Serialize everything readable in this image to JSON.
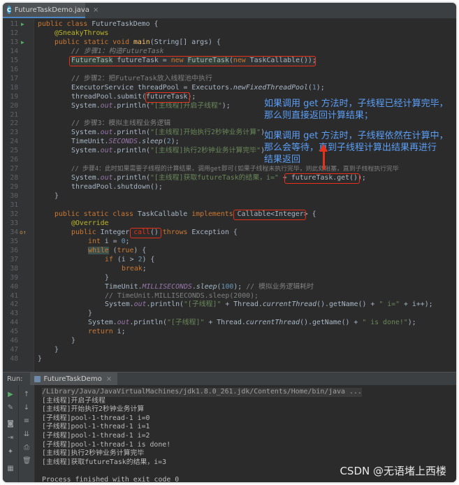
{
  "tab": {
    "file_icon": "C",
    "name": "FutureTaskDemo.java",
    "close": "×"
  },
  "code_lines": [
    {
      "n": "11",
      "icon": "run"
    },
    {
      "n": "12",
      "icon": ""
    },
    {
      "n": "13",
      "icon": "run"
    },
    {
      "n": "14",
      "icon": ""
    },
    {
      "n": "15",
      "icon": ""
    },
    {
      "n": "16",
      "icon": ""
    },
    {
      "n": "17",
      "icon": ""
    },
    {
      "n": "18",
      "icon": ""
    },
    {
      "n": "19",
      "icon": ""
    },
    {
      "n": "20",
      "icon": ""
    },
    {
      "n": "21",
      "icon": ""
    },
    {
      "n": "22",
      "icon": ""
    },
    {
      "n": "23",
      "icon": ""
    },
    {
      "n": "24",
      "icon": ""
    },
    {
      "n": "25",
      "icon": ""
    },
    {
      "n": "26",
      "icon": ""
    },
    {
      "n": "27",
      "icon": ""
    },
    {
      "n": "28",
      "icon": ""
    },
    {
      "n": "29",
      "icon": ""
    },
    {
      "n": "30",
      "icon": ""
    },
    {
      "n": "31",
      "icon": ""
    },
    {
      "n": "32",
      "icon": ""
    },
    {
      "n": "33",
      "icon": ""
    },
    {
      "n": "34",
      "icon": "override"
    },
    {
      "n": "35",
      "icon": ""
    },
    {
      "n": "36",
      "icon": ""
    },
    {
      "n": "37",
      "icon": ""
    },
    {
      "n": "38",
      "icon": ""
    },
    {
      "n": "39",
      "icon": ""
    },
    {
      "n": "40",
      "icon": ""
    },
    {
      "n": "41",
      "icon": ""
    },
    {
      "n": "42",
      "icon": ""
    },
    {
      "n": "43",
      "icon": ""
    },
    {
      "n": "44",
      "icon": ""
    },
    {
      "n": "45",
      "icon": ""
    },
    {
      "n": "46",
      "icon": ""
    },
    {
      "n": "47",
      "icon": ""
    },
    {
      "n": "48",
      "icon": ""
    }
  ],
  "code": {
    "l11": {
      "kw": "public class ",
      "name": "FutureTaskDemo {"
    },
    "l12": {
      "ann": "@SneakyThrows"
    },
    "l13": {
      "kw": "public static void ",
      "fn": "main",
      "rest": "(String[] args) {"
    },
    "l14": {
      "cm": "// 步骤1：构造FutureTask"
    },
    "l15": {
      "t1": "FutureTask",
      "t2": " futureTask",
      "t3": " = ",
      "kw": "new ",
      "t4": "FutureTask",
      "t5": "(",
      "kw2": "new ",
      "t6": "TaskCallable());"
    },
    "l17": {
      "cm": "// 步骤2：把FutureTask放入线程池中执行"
    },
    "l18": {
      "a": "ExecutorService ",
      "b": "threadPool",
      "c": " = Executors.",
      "d": "newFixedThreadPool",
      "e": "(",
      "num": "1",
      "f": ");"
    },
    "l19": {
      "a": "threadPool.submit(",
      "b": "futureTask",
      "c": ");"
    },
    "l20": {
      "a": "System.",
      "b": "out",
      "c": ".println(",
      "s": "\"[主线程]开启子线程\"",
      "d": ");"
    },
    "l22": {
      "cm": "// 步骤3：模拟主线程业务逻辑"
    },
    "l23": {
      "a": "System.",
      "b": "out",
      "c": ".println(",
      "s": "\"[主线程]开始执行2秒钟业务计算\"",
      "d": ");"
    },
    "l24": {
      "a": "TimeUnit.",
      "b": "SECONDS",
      "c": ".",
      "d": "sleep",
      "e": "(",
      "num": "2",
      "f": ");"
    },
    "l25": {
      "a": "System.",
      "b": "out",
      "c": ".println(",
      "s": "\"[主线程]执行2秒钟业务计算完毕\"",
      "d": ");"
    },
    "l27": {
      "cm": "// 步骤4：此时如果需要子线程的计算结果，调用get即可(如果子线程未执行完毕，则此处阻塞，直到子线程执行完毕"
    },
    "l28": {
      "a": "System.",
      "b": "out",
      "c": ".println(",
      "s": "\"[主线程]获取futureTask的结果，i=\"",
      "d": " + ",
      "e": "futureTask.get()",
      "f": ");"
    },
    "l29": {
      "a": "threadPool.shutdown();"
    },
    "l30": {
      "a": "}"
    },
    "l32": {
      "kw": "public static class ",
      "name": "TaskCallable ",
      "kw2": "implements ",
      "iface": "Callable<Integer>",
      "end": " {"
    },
    "l33": {
      "ann": "@Override"
    },
    "l34": {
      "kw": "public ",
      "type": "Integer ",
      "fn": "call",
      "paren": "()",
      "kw2": " throws ",
      "end": "Exception {"
    },
    "l35": {
      "kw": "int ",
      "a": "i = ",
      "num": "0",
      "b": ";"
    },
    "l36": {
      "kw": "while",
      "a": " (",
      "kw2": "true",
      "b": ") {"
    },
    "l37": {
      "kw": "if ",
      "a": "(i > ",
      "num": "2",
      "b": ") {"
    },
    "l38": {
      "kw": "break",
      "a": ";"
    },
    "l39": {
      "a": "}"
    },
    "l40": {
      "a": "TimeUnit.",
      "b": "MILLISECONDS",
      "c": ".",
      "d": "sleep",
      "e": "(",
      "num": "100",
      "f": "); ",
      "cm": "// 模拟业务逻辑耗时"
    },
    "l41": {
      "cm": "// TimeUnit.MILLISECONDS.sleep(2000);"
    },
    "l42": {
      "a": "System.",
      "b": "out",
      "c": ".println(",
      "s": "\"[子线程]\"",
      "d": " + Thread.",
      "e": "currentThread",
      "f": "().getName() + ",
      "s2": "\" i=\"",
      "g": " + i++);"
    },
    "l43": {
      "a": "}"
    },
    "l44": {
      "a": "System.",
      "b": "out",
      "c": ".println(",
      "s": "\"[子线程]\"",
      "d": " + Thread.",
      "e": "currentThread",
      "f": "().getName() + ",
      "s2": "\" is done!\"",
      "g": ");"
    },
    "l45": {
      "kw": "return ",
      "a": "i;"
    },
    "l46": {
      "a": "}"
    },
    "l47": {
      "a": "}"
    },
    "l48": {
      "a": "}"
    }
  },
  "notes": {
    "n1a": "如果调用 get 方法时，子线程已经计算完毕，",
    "n1b": "那么则直接返回计算结果；",
    "n2a": "如果调用 get 方法时，子线程依然在计算中，",
    "n2b": "那么会等待，直到子线程计算出结果再进行",
    "n2c": "结果返回"
  },
  "run": {
    "label": "Run:",
    "tab_name": "FutureTaskDemo",
    "tab_close": "×",
    "output": [
      "/Library/Java/JavaVirtualMachines/jdk1.8.0_261.jdk/Contents/Home/bin/java ...",
      "[主线程]开启子线程",
      "[主线程]开始执行2秒钟业务计算",
      "[子线程]pool-1-thread-1 i=0",
      "[子线程]pool-1-thread-1 i=1",
      "[子线程]pool-1-thread-1 i=2",
      "[子线程]pool-1-thread-1 is done!",
      "[主线程]执行2秒钟业务计算完毕",
      "[主线程]获取futureTask的结果，i=3",
      "",
      "Process finished with exit code 0"
    ]
  },
  "watermark": "CSDN @无语堵上西楼",
  "colors": {
    "annotation_box": "#e8311a",
    "note_text": "#5b9ff7",
    "editor_bg": "#2b2b2b"
  }
}
